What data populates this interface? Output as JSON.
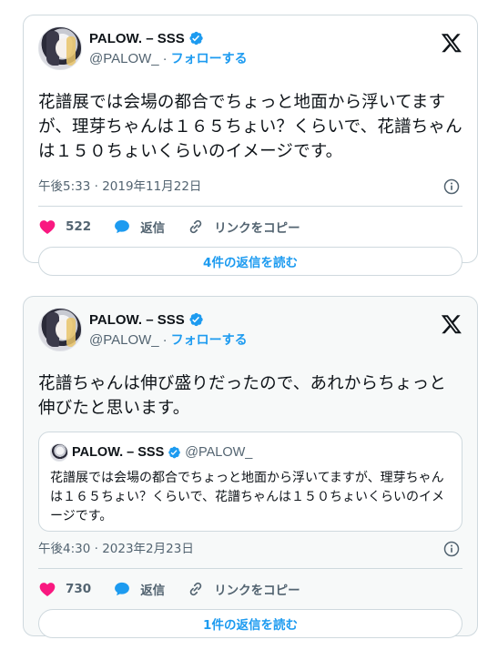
{
  "tweets": [
    {
      "author": {
        "display_name": "PALOW. – SSS",
        "handle": "@PALOW_"
      },
      "follow_label": "フォローする",
      "text": "花譜展では会場の都合でちょっと地面から浮いてますが、理芽ちゃんは１６５ちょい？くらいで、花譜ちゃんは１５０ちょいくらいのイメージです。",
      "timestamp": "午後5:33 · 2019年11月22日",
      "likes": "522",
      "reply_label": "返信",
      "copy_link_label": "リンクをコピー",
      "read_replies_label": "4件の返信を読む"
    },
    {
      "author": {
        "display_name": "PALOW. – SSS",
        "handle": "@PALOW_"
      },
      "follow_label": "フォローする",
      "text": "花譜ちゃんは伸び盛りだったので、あれからちょっと伸びたと思います。",
      "quote": {
        "display_name": "PALOW. – SSS",
        "handle": "@PALOW_",
        "text": "花譜展では会場の都合でちょっと地面から浮いてますが、理芽ちゃんは１６５ちょい？くらいで、花譜ちゃんは１５０ちょいくらいのイメージです。"
      },
      "timestamp": "午後4:30 · 2023年2月23日",
      "likes": "730",
      "reply_label": "返信",
      "copy_link_label": "リンクをコピー",
      "read_replies_label": "1件の返信を読む"
    }
  ],
  "colors": {
    "accent": "#1d9bf0",
    "like": "#f91880",
    "muted": "#536471",
    "text": "#0f1419",
    "border": "#cfd9de"
  },
  "icons": [
    "verified-badge-icon",
    "x-logo-icon",
    "info-icon",
    "heart-icon",
    "reply-bubble-icon",
    "link-icon"
  ]
}
